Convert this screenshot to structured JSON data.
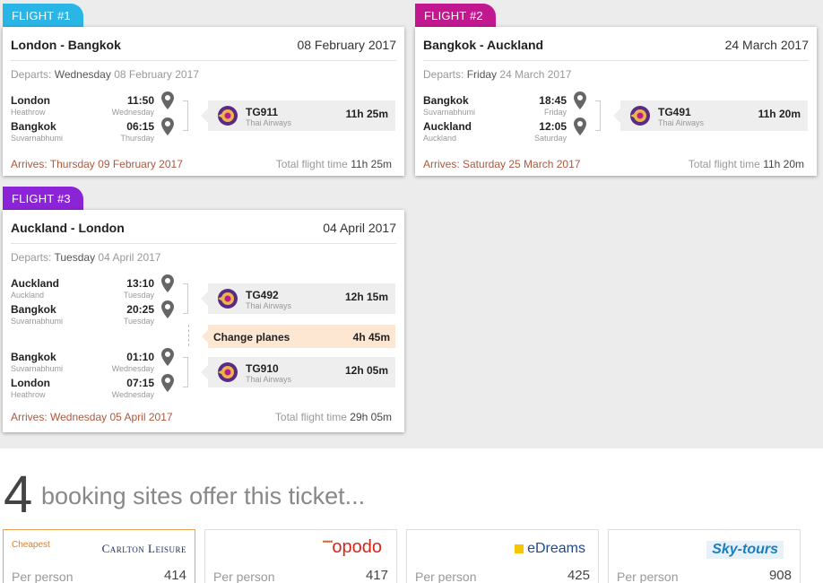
{
  "flights": [
    {
      "tag": "FLIGHT #1",
      "tag_color": "#29b6e6",
      "route": "London - Bangkok",
      "date": "08 February 2017",
      "departs_label": "Departs:",
      "departs_day": "Wednesday",
      "departs_date": "08 February 2017",
      "segments": [
        {
          "from": {
            "city": "London",
            "airport": "Heathrow",
            "time": "11:50",
            "day": "Wednesday"
          },
          "to": {
            "city": "Bangkok",
            "airport": "Suvarnabhumi",
            "time": "06:15",
            "day": "Thursday"
          },
          "flight_no": "TG911",
          "airline": "Thai Airways",
          "duration": "11h 25m"
        }
      ],
      "arrives": "Arrives: Thursday 09 February 2017",
      "total_label": "Total flight time",
      "total_value": "11h 25m"
    },
    {
      "tag": "FLIGHT #2",
      "tag_color": "#c2188f",
      "route": "Bangkok - Auckland",
      "date": "24 March 2017",
      "departs_label": "Departs:",
      "departs_day": "Friday",
      "departs_date": "24 March 2017",
      "segments": [
        {
          "from": {
            "city": "Bangkok",
            "airport": "Suvarnabhumi",
            "time": "18:45",
            "day": "Friday"
          },
          "to": {
            "city": "Auckland",
            "airport": "Auckland",
            "time": "12:05",
            "day": "Saturday"
          },
          "flight_no": "TG491",
          "airline": "Thai Airways",
          "duration": "11h 20m"
        }
      ],
      "arrives": "Arrives: Saturday 25 March 2017",
      "total_label": "Total flight time",
      "total_value": "11h 20m"
    },
    {
      "tag": "FLIGHT #3",
      "tag_color": "#8a24d6",
      "route": "Auckland - London",
      "date": "04 April 2017",
      "departs_label": "Departs:",
      "departs_day": "Tuesday",
      "departs_date": "04 April 2017",
      "segments": [
        {
          "from": {
            "city": "Auckland",
            "airport": "Auckland",
            "time": "13:10",
            "day": "Tuesday"
          },
          "to": {
            "city": "Bangkok",
            "airport": "Suvarnabhumi",
            "time": "20:25",
            "day": "Tuesday"
          },
          "flight_no": "TG492",
          "airline": "Thai Airways",
          "duration": "12h 15m"
        },
        {
          "from": {
            "city": "Bangkok",
            "airport": "Suvarnabhumi",
            "time": "01:10",
            "day": "Wednesday"
          },
          "to": {
            "city": "London",
            "airport": "Heathrow",
            "time": "07:15",
            "day": "Wednesday"
          },
          "flight_no": "TG910",
          "airline": "Thai Airways",
          "duration": "12h 05m"
        }
      ],
      "change": {
        "label": "Change planes",
        "duration": "4h 45m"
      },
      "arrives": "Arrives: Wednesday 05 April 2017",
      "total_label": "Total flight time",
      "total_value": "29h 05m"
    }
  ],
  "offers": {
    "count": "4",
    "text": "booking sites offer this ticket..."
  },
  "sites": [
    {
      "brand": "Carlton Leisure",
      "cheapest_label": "Cheapest",
      "per_person": "Per person",
      "price": "414"
    },
    {
      "brand": "opodo",
      "per_person": "Per person",
      "price": "417"
    },
    {
      "brand": "eDreams",
      "per_person": "Per person",
      "price": "425"
    },
    {
      "brand": "Sky-tours",
      "per_person": "Per person",
      "price": "908"
    }
  ],
  "colors": {
    "arrives": "#b0573c",
    "cheapest_border": "#e8a25a",
    "change_bg": "#fde7d2",
    "page_bg": "#ececec"
  }
}
